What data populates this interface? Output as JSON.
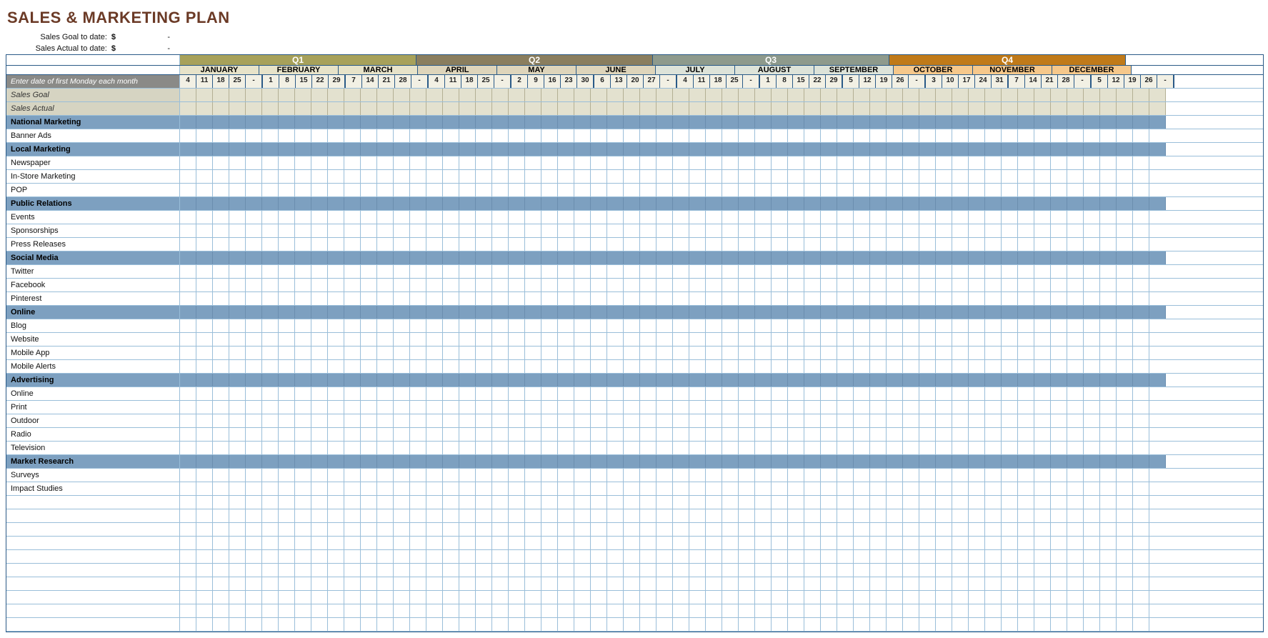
{
  "title": "SALES & MARKETING PLAN",
  "summary": {
    "goal": {
      "label": "Sales Goal to date:",
      "currency": "$",
      "value": "-"
    },
    "actual": {
      "label": "Sales Actual to date:",
      "currency": "$",
      "value": "-"
    }
  },
  "date_hint": "Enter date of first Monday each month",
  "quarters": [
    {
      "name": "Q1",
      "fill": "#a7a15a",
      "months": [
        {
          "name": "JANUARY",
          "fill": "#e7e3c9",
          "days": [
            "4",
            "11",
            "18",
            "25",
            "-"
          ]
        },
        {
          "name": "FEBRUARY",
          "fill": "#e7e3c9",
          "days": [
            "1",
            "8",
            "15",
            "22",
            "29"
          ]
        },
        {
          "name": "MARCH",
          "fill": "#e7e3c9",
          "days": [
            "7",
            "14",
            "21",
            "28",
            "-"
          ]
        }
      ]
    },
    {
      "name": "Q2",
      "fill": "#8a7e5e",
      "months": [
        {
          "name": "APRIL",
          "fill": "#ded5bb",
          "days": [
            "4",
            "11",
            "18",
            "25",
            "-"
          ]
        },
        {
          "name": "MAY",
          "fill": "#ded5bb",
          "days": [
            "2",
            "9",
            "16",
            "23",
            "30"
          ]
        },
        {
          "name": "JUNE",
          "fill": "#ded5bb",
          "days": [
            "6",
            "13",
            "20",
            "27",
            "-"
          ]
        }
      ]
    },
    {
      "name": "Q3",
      "fill": "#8e9a8c",
      "months": [
        {
          "name": "JULY",
          "fill": "#dde3d9",
          "days": [
            "4",
            "11",
            "18",
            "25",
            "-"
          ]
        },
        {
          "name": "AUGUST",
          "fill": "#dde3d9",
          "days": [
            "1",
            "8",
            "15",
            "22",
            "29"
          ]
        },
        {
          "name": "SEPTEMBER",
          "fill": "#dde3d9",
          "days": [
            "5",
            "12",
            "19",
            "26",
            "-"
          ]
        }
      ]
    },
    {
      "name": "Q4",
      "fill": "#c07a19",
      "months": [
        {
          "name": "OCTOBER",
          "fill": "#f6c88b",
          "days": [
            "3",
            "10",
            "17",
            "24",
            "31"
          ]
        },
        {
          "name": "NOVEMBER",
          "fill": "#f6c88b",
          "days": [
            "7",
            "14",
            "21",
            "28",
            "-"
          ]
        },
        {
          "name": "DECEMBER",
          "fill": "#f6c88b",
          "days": [
            "5",
            "12",
            "19",
            "26",
            "-"
          ]
        }
      ]
    }
  ],
  "summary_rows": [
    "Sales Goal",
    "Sales Actual"
  ],
  "sections": [
    {
      "name": "National Marketing",
      "items": [
        "Banner Ads"
      ]
    },
    {
      "name": "Local Marketing",
      "items": [
        "Newspaper",
        "In-Store Marketing",
        "POP"
      ]
    },
    {
      "name": "Public Relations",
      "items": [
        "Events",
        "Sponsorships",
        "Press Releases"
      ]
    },
    {
      "name": "Social Media",
      "items": [
        "Twitter",
        "Facebook",
        "Pinterest"
      ]
    },
    {
      "name": "Online",
      "items": [
        "Blog",
        "Website",
        "Mobile App",
        "Mobile Alerts"
      ]
    },
    {
      "name": "Advertising",
      "items": [
        "Online",
        "Print",
        "Outdoor",
        "Radio",
        "Television"
      ]
    },
    {
      "name": "Market Research",
      "items": [
        "Surveys",
        "Impact Studies"
      ]
    }
  ],
  "blank_rows": 10,
  "colors": {
    "border": "#2a5a87",
    "grid": "#9abed9",
    "cat_bg": "#7da0c0",
    "sg_bg": "#d6d4c2",
    "date_label_bg": "#8a8a87"
  }
}
